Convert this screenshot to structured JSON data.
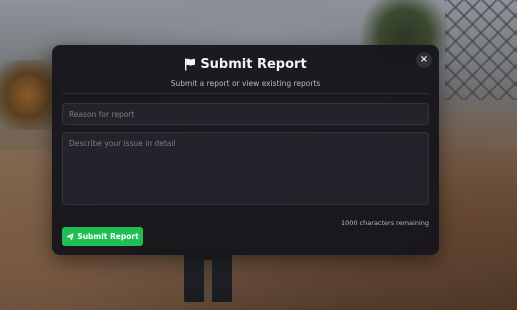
{
  "modal": {
    "title": "Submit Report",
    "title_icon": "flag-icon",
    "subtitle": "Submit a report or view existing reports",
    "close_label": "×"
  },
  "form": {
    "reason_placeholder": "Reason for report",
    "reason_value": "",
    "details_placeholder": "Describe your issue in detail",
    "details_value": "",
    "characters_remaining": "1000 characters remaining",
    "submit_label": "Submit Report",
    "submit_icon": "send-icon"
  },
  "colors": {
    "modal_background": "#16161c",
    "submit_green": "#1fbf55",
    "input_background": "#23242b"
  }
}
